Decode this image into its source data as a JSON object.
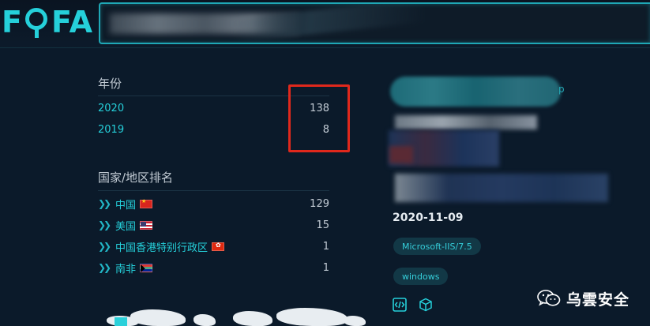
{
  "app": {
    "logo_text": [
      "F",
      "FA"
    ]
  },
  "search": {
    "query": ""
  },
  "year_section": {
    "title": "年份",
    "rows": [
      {
        "label": "2020",
        "count": "138"
      },
      {
        "label": "2019",
        "count": "8"
      }
    ]
  },
  "country_section": {
    "title": "国家/地区排名",
    "rows": [
      {
        "label": "中国",
        "count": "129",
        "flag": "cn-flag-icon"
      },
      {
        "label": "美国",
        "count": "15",
        "flag": "us-flag-icon"
      },
      {
        "label": "中国香港特别行政区",
        "count": "1",
        "flag": "hk-flag-icon"
      },
      {
        "label": "南非",
        "count": "1",
        "flag": "za-flag-icon"
      }
    ]
  },
  "result": {
    "date": "2020-11-09",
    "server_tag": "Microsoft-IIS/7.5",
    "os_tag": "windows",
    "icons": [
      "code-icon",
      "cube-icon"
    ]
  },
  "watermark": {
    "text": "乌雲安全",
    "icon": "wechat-icon"
  },
  "colors": {
    "accent": "#25d0da",
    "background": "#0b1a2a",
    "highlight_box": "#e0281c"
  }
}
